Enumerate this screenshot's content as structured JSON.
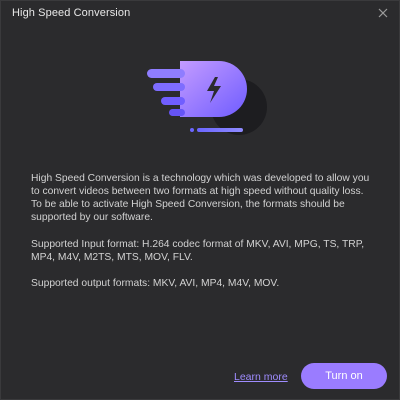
{
  "dialog": {
    "title": "High Speed Conversion",
    "paragraphs": [
      "High Speed Conversion is a technology which was developed to allow you to convert videos between two formats at high speed without quality loss. To be able to activate High Speed Conversion, the formats should be supported by our software.",
      "Supported Input format: H.264 codec format of MKV, AVI, MPG, TS, TRP, MP4, M4V, M2TS, MTS, MOV, FLV.",
      "Supported output formats: MKV, AVI, MP4, M4V, MOV."
    ],
    "learn_more": "Learn more",
    "turn_on": "Turn on"
  },
  "icons": {
    "close": "close-icon",
    "illustration": "lightning-speed-icon"
  },
  "colors": {
    "background": "#2b2b2d",
    "accent": "#9a7cff",
    "link": "#9f8cff",
    "text": "#d2d2d2"
  }
}
